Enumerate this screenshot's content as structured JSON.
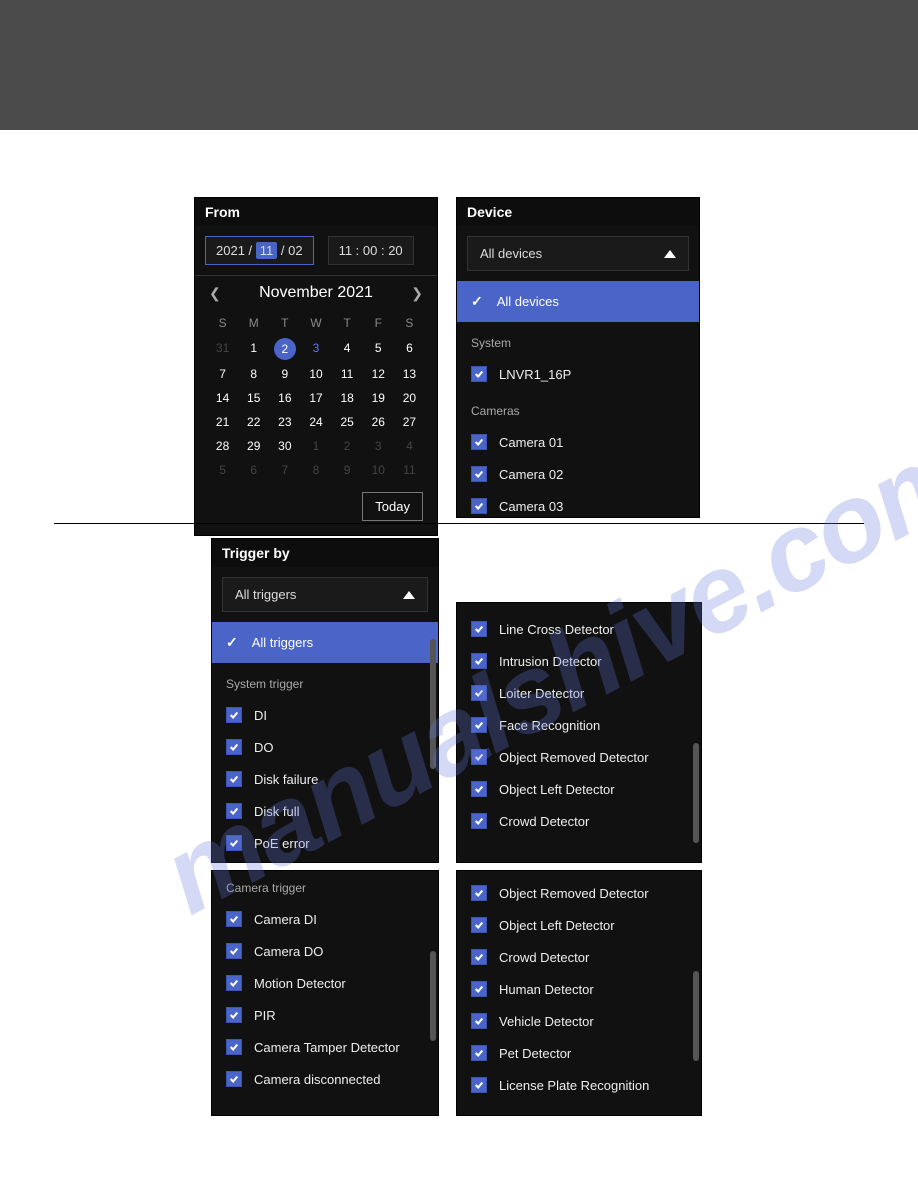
{
  "from": {
    "title": "From",
    "year": "2021",
    "month": "11",
    "day": "02",
    "time": "11 : 00 : 20",
    "cal_title": "November 2021",
    "dow": [
      "S",
      "M",
      "T",
      "W",
      "T",
      "F",
      "S"
    ],
    "days": [
      {
        "n": "31",
        "muted": true
      },
      {
        "n": "1"
      },
      {
        "n": "2",
        "selected": true
      },
      {
        "n": "3",
        "blue": true
      },
      {
        "n": "4"
      },
      {
        "n": "5"
      },
      {
        "n": "6"
      },
      {
        "n": "7"
      },
      {
        "n": "8"
      },
      {
        "n": "9"
      },
      {
        "n": "10"
      },
      {
        "n": "11"
      },
      {
        "n": "12"
      },
      {
        "n": "13"
      },
      {
        "n": "14"
      },
      {
        "n": "15"
      },
      {
        "n": "16"
      },
      {
        "n": "17"
      },
      {
        "n": "18"
      },
      {
        "n": "19"
      },
      {
        "n": "20"
      },
      {
        "n": "21"
      },
      {
        "n": "22"
      },
      {
        "n": "23"
      },
      {
        "n": "24"
      },
      {
        "n": "25"
      },
      {
        "n": "26"
      },
      {
        "n": "27"
      },
      {
        "n": "28"
      },
      {
        "n": "29"
      },
      {
        "n": "30"
      },
      {
        "n": "1",
        "muted": true
      },
      {
        "n": "2",
        "muted": true
      },
      {
        "n": "3",
        "muted": true
      },
      {
        "n": "4",
        "muted": true
      },
      {
        "n": "5",
        "muted": true
      },
      {
        "n": "6",
        "muted": true
      },
      {
        "n": "7",
        "muted": true
      },
      {
        "n": "8",
        "muted": true
      },
      {
        "n": "9",
        "muted": true
      },
      {
        "n": "10",
        "muted": true
      },
      {
        "n": "11",
        "muted": true
      }
    ],
    "today": "Today"
  },
  "device": {
    "title": "Device",
    "selected": "All devices",
    "all": "All devices",
    "group_system": "System",
    "system_items": [
      "LNVR1_16P"
    ],
    "group_cameras": "Cameras",
    "camera_items": [
      "Camera 01",
      "Camera 02",
      "Camera 03"
    ]
  },
  "trigger": {
    "title": "Trigger by",
    "selected": "All triggers",
    "all": "All triggers",
    "group_system": "System trigger",
    "system_items": [
      "DI",
      "DO",
      "Disk failure",
      "Disk full",
      "PoE error"
    ],
    "col2_items": [
      "Line Cross Detector",
      "Intrusion Detector",
      "Loiter Detector",
      "Face Recognition",
      "Object Removed Detector",
      "Object Left Detector",
      "Crowd Detector"
    ],
    "group_camera": "Camera trigger",
    "camera_items": [
      "Camera DI",
      "Camera DO",
      "Motion Detector",
      "PIR",
      "Camera Tamper Detector",
      "Camera disconnected"
    ],
    "col4_items": [
      "Object Removed Detector",
      "Object Left Detector",
      "Crowd Detector",
      "Human Detector",
      "Vehicle Detector",
      "Pet Detector",
      "License Plate Recognition"
    ]
  },
  "watermark": "manualshive.com"
}
